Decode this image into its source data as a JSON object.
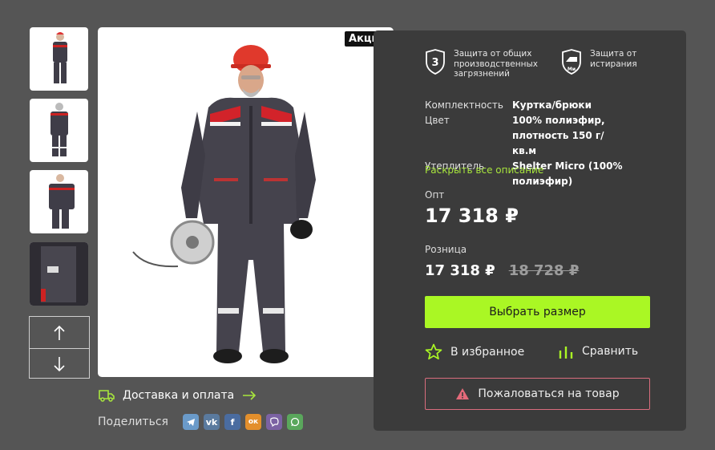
{
  "gallery": {
    "badge": "Акция",
    "thumbnails": [
      "front",
      "back",
      "side",
      "detail"
    ]
  },
  "delivery": {
    "label": "Доставка и оплата"
  },
  "share": {
    "label": "Поделиться",
    "networks": [
      "telegram",
      "vk",
      "facebook",
      "odnoklassniki",
      "viber",
      "whatsapp"
    ],
    "vk_text": "vk",
    "fb_text": "f",
    "ok_text": "ок"
  },
  "features": [
    {
      "icon": "shield-3-icon",
      "badge_text": "3",
      "text": "Защита от общих производственных загрязнений"
    },
    {
      "icon": "abrasion-icon",
      "badge_text": "Ми",
      "text": "Защита от истирания"
    }
  ],
  "specs": [
    {
      "key": "Комплектность",
      "value": "Куртка/брюки"
    },
    {
      "key": "Цвет",
      "value": "100% полиэфир, плотность 150 г/кв.м"
    },
    {
      "key": "Утеплитель",
      "value": "Shelter Micro (100% полиэфир)"
    }
  ],
  "more_link": "Раскрыть все описание",
  "prices": {
    "wholesale_label": "Опт",
    "wholesale": "17 318 ₽",
    "retail_label": "Розница",
    "retail": "17 318 ₽",
    "retail_old": "18 728 ₽"
  },
  "actions": {
    "choose_size": "Выбрать размер",
    "favorite": "В избранное",
    "compare": "Сравнить",
    "report": "Пожаловаться на товар"
  },
  "colors": {
    "accent": "#aaf724",
    "panel": "#3b3b3b",
    "background": "#555555",
    "report_border": "#d96d7e",
    "link": "#a8e63d"
  }
}
